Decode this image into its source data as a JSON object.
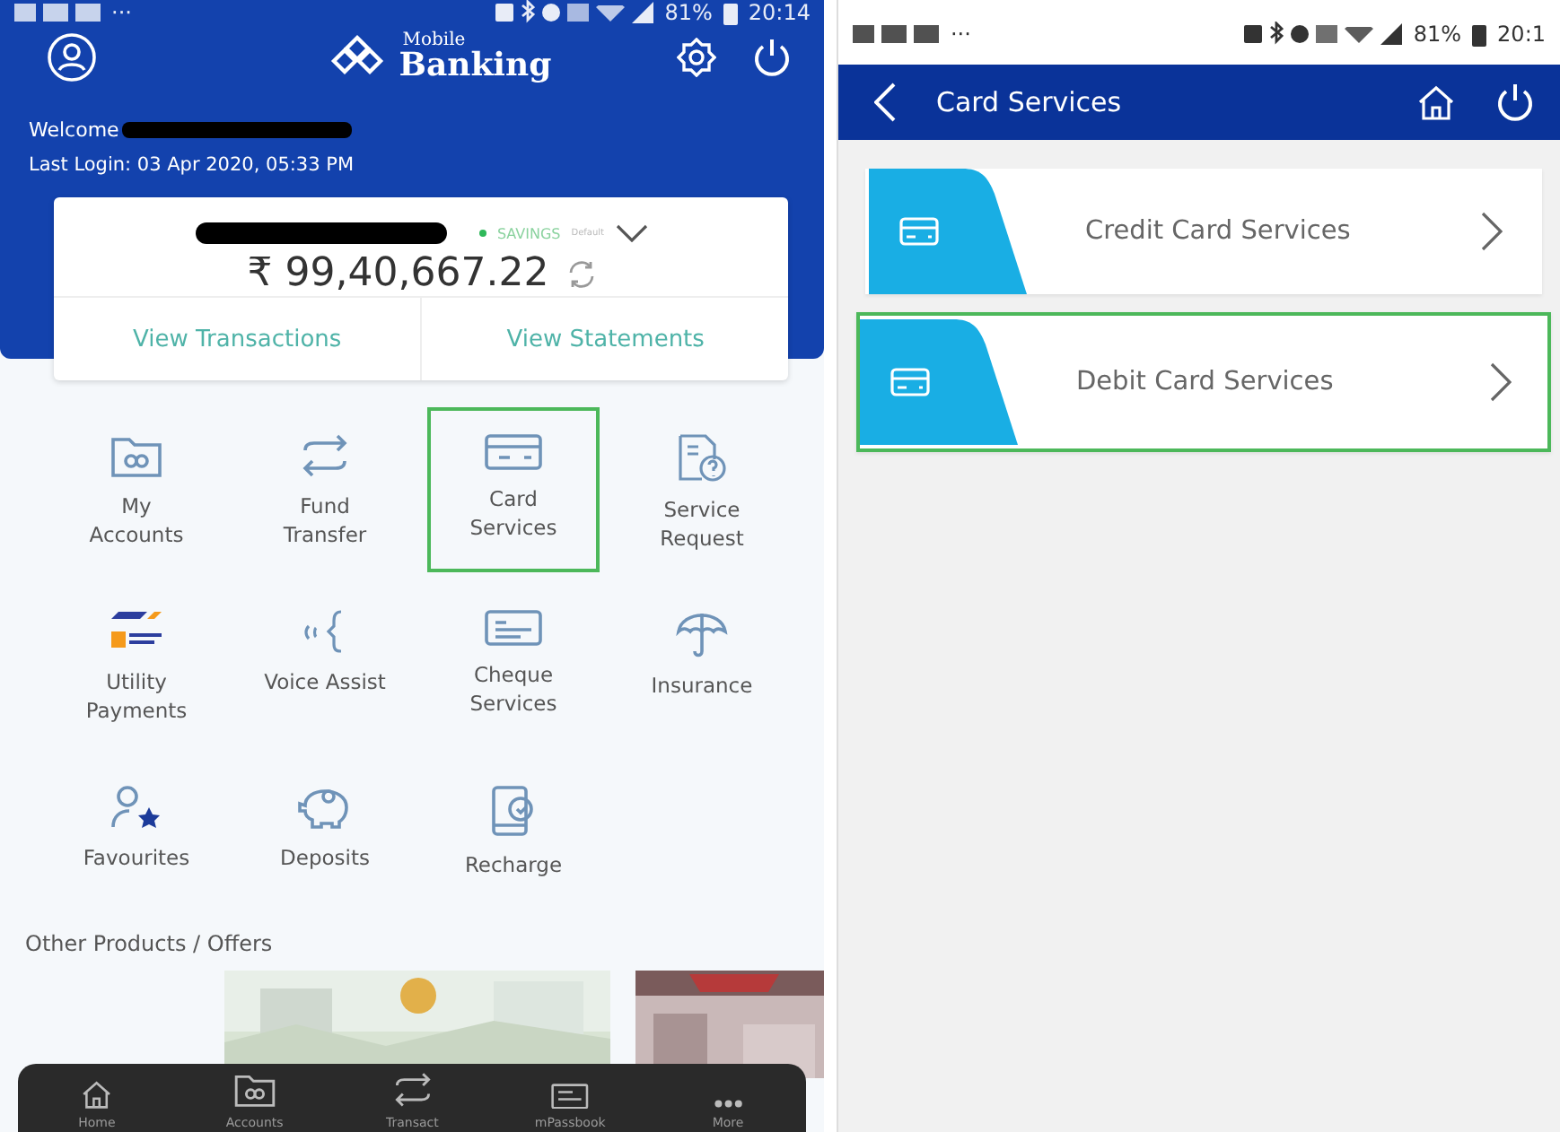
{
  "home_screen": {
    "status_bar": {
      "overflow": "···",
      "battery": "81%",
      "time": "20:14"
    },
    "header": {
      "logo_small": "Mobile",
      "logo_title": "Banking"
    },
    "welcome": {
      "label": "Welcome",
      "last_login": "Last Login: 03 Apr 2020, 05:33 PM"
    },
    "account_card": {
      "account_type": "SAVINGS",
      "default_tag": "Default",
      "balance": "₹ 99,40,667.22",
      "actions": [
        "View Transactions",
        "View Statements"
      ]
    },
    "services": [
      {
        "kind": "folder",
        "label": "My\nAccounts",
        "selected": false
      },
      {
        "kind": "transfer",
        "label": "Fund\nTransfer",
        "selected": false
      },
      {
        "kind": "card",
        "label": "Card\nServices",
        "selected": true
      },
      {
        "kind": "request",
        "label": "Service\nRequest",
        "selected": false
      },
      {
        "kind": "billpay",
        "label": "Utility\nPayments",
        "selected": false
      },
      {
        "kind": "voice",
        "label": "Voice Assist",
        "selected": false
      },
      {
        "kind": "cheque",
        "label": "Cheque\nServices",
        "selected": false
      },
      {
        "kind": "umbrella",
        "label": "Insurance",
        "selected": false
      },
      {
        "kind": "favourites",
        "label": "Favourites",
        "selected": false
      },
      {
        "kind": "piggy",
        "label": "Deposits",
        "selected": false
      },
      {
        "kind": "recharge",
        "label": "Recharge",
        "selected": false
      }
    ],
    "offers_title": "Other Products / Offers",
    "bottom_nav": [
      {
        "kind": "home",
        "label": "Home"
      },
      {
        "kind": "folder",
        "label": "Accounts"
      },
      {
        "kind": "transfer",
        "label": "Transact"
      },
      {
        "kind": "passbook",
        "label": "mPassbook"
      },
      {
        "kind": "more",
        "label": "More"
      }
    ]
  },
  "card_services_screen": {
    "status_bar": {
      "overflow": "···",
      "battery": "81%",
      "time": "20:1"
    },
    "title": "Card Services",
    "items": [
      {
        "label": "Credit Card Services",
        "selected": false
      },
      {
        "label": "Debit Card Services",
        "selected": true
      }
    ]
  }
}
